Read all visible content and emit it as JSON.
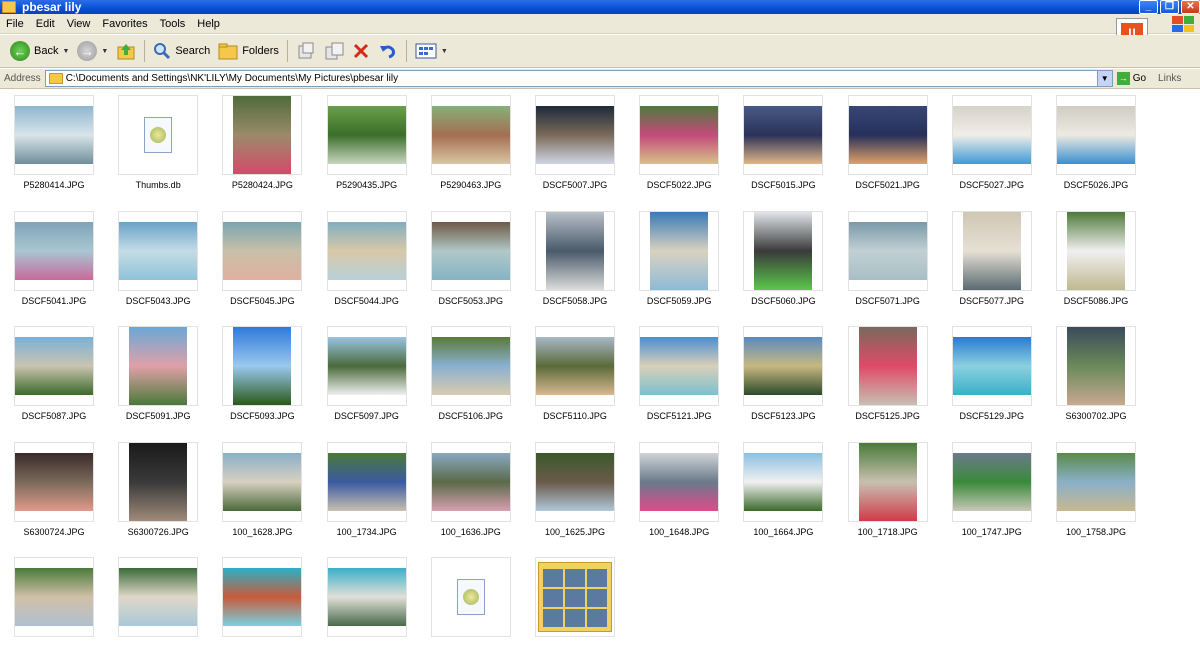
{
  "window": {
    "title": "pbesar lily",
    "min": "_",
    "max": "❐",
    "close": "✕"
  },
  "menu": [
    "File",
    "Edit",
    "View",
    "Favorites",
    "Tools",
    "Help"
  ],
  "toolbar": {
    "back": "Back",
    "search": "Search",
    "folders": "Folders"
  },
  "address": {
    "label": "Address",
    "path": "C:\\Documents and Settings\\NK'LILY\\My Documents\\My Pictures\\pbesar lily",
    "go": "Go",
    "links": "Links"
  },
  "files": [
    {
      "name": "P5280414.JPG",
      "kind": "land",
      "colors": [
        "#8fb6cf",
        "#6f8f9a",
        "#d8e4ea"
      ]
    },
    {
      "name": "Thumbs.db",
      "kind": "db"
    },
    {
      "name": "P5280424.JPG",
      "kind": "port",
      "colors": [
        "#4f6b3a",
        "#d44a6a",
        "#9c8a6a"
      ]
    },
    {
      "name": "P5290435.JPG",
      "kind": "land",
      "colors": [
        "#6aa04a",
        "#c9d6c0",
        "#3b6e2a"
      ]
    },
    {
      "name": "P5290463.JPG",
      "kind": "land",
      "colors": [
        "#86b07a",
        "#d9c6a4",
        "#a46e52"
      ]
    },
    {
      "name": "DSCF5007.JPG",
      "kind": "land",
      "colors": [
        "#1e2a3a",
        "#cfd6e2",
        "#7a6a5a"
      ]
    },
    {
      "name": "DSCF5022.JPG",
      "kind": "land",
      "colors": [
        "#4e7a3c",
        "#d7c08a",
        "#c44a7a"
      ]
    },
    {
      "name": "DSCF5015.JPG",
      "kind": "land",
      "colors": [
        "#4a5a86",
        "#e2b58a",
        "#2a3258"
      ]
    },
    {
      "name": "DSCF5021.JPG",
      "kind": "land",
      "colors": [
        "#384676",
        "#e0a268",
        "#26305a"
      ]
    },
    {
      "name": "DSCF5027.JPG",
      "kind": "land",
      "colors": [
        "#d6d2c8",
        "#3f9ad6",
        "#f0eee8"
      ]
    },
    {
      "name": "DSCF5026.JPG",
      "kind": "land",
      "colors": [
        "#d0ccc2",
        "#3a8fd0",
        "#eceae2"
      ]
    },
    {
      "name": "DSCF5041.JPG",
      "kind": "land",
      "colors": [
        "#7ea4b8",
        "#c86a9a",
        "#a8c6d2"
      ]
    },
    {
      "name": "DSCF5043.JPG",
      "kind": "land",
      "colors": [
        "#6aa2c8",
        "#8fc2d8",
        "#c4dce6"
      ]
    },
    {
      "name": "DSCF5045.JPG",
      "kind": "land",
      "colors": [
        "#7aa6b0",
        "#e0b0a0",
        "#c8c0a8"
      ]
    },
    {
      "name": "DSCF5044.JPG",
      "kind": "land",
      "colors": [
        "#82aec0",
        "#b8d0d8",
        "#d8c8a8"
      ]
    },
    {
      "name": "DSCF5053.JPG",
      "kind": "land",
      "colors": [
        "#6e5a46",
        "#86b4c4",
        "#b0c8c8"
      ]
    },
    {
      "name": "DSCF5058.JPG",
      "kind": "port",
      "colors": [
        "#b8c0c8",
        "#dcdcdc",
        "#4a5a6a"
      ]
    },
    {
      "name": "DSCF5059.JPG",
      "kind": "port",
      "colors": [
        "#3a7ab8",
        "#8ebad6",
        "#d8d2c0"
      ]
    },
    {
      "name": "DSCF5060.JPG",
      "kind": "port",
      "colors": [
        "#e2e6ea",
        "#5ac84a",
        "#3a3a3a"
      ]
    },
    {
      "name": "DSCF5071.JPG",
      "kind": "land",
      "colors": [
        "#7a9aa8",
        "#a8bec6",
        "#c2d0d4"
      ]
    },
    {
      "name": "DSCF5077.JPG",
      "kind": "port",
      "colors": [
        "#d0c6b4",
        "#5a6a72",
        "#e6e0d4"
      ]
    },
    {
      "name": "DSCF5086.JPG",
      "kind": "port",
      "colors": [
        "#4e7a3a",
        "#c0b890",
        "#f0f0f0"
      ]
    },
    {
      "name": "DSCF5087.JPG",
      "kind": "land",
      "colors": [
        "#7ab0d8",
        "#3c6a2a",
        "#c9c4b0"
      ]
    },
    {
      "name": "DSCF5091.JPG",
      "kind": "port",
      "colors": [
        "#6aa8d8",
        "#4a7a3a",
        "#e0a0a8"
      ]
    },
    {
      "name": "DSCF5093.JPG",
      "kind": "port",
      "colors": [
        "#2f7ad8",
        "#2a5a1a",
        "#9ac8f0"
      ]
    },
    {
      "name": "DSCF5097.JPG",
      "kind": "land",
      "colors": [
        "#9ac4e2",
        "#f0f0f0",
        "#4a6a3a"
      ]
    },
    {
      "name": "DSCF5106.JPG",
      "kind": "land",
      "colors": [
        "#5a7a3a",
        "#d8cbb0",
        "#8ab0d0"
      ]
    },
    {
      "name": "DSCF5110.JPG",
      "kind": "land",
      "colors": [
        "#a8b8c8",
        "#d8b890",
        "#5a6a3a"
      ]
    },
    {
      "name": "DSCF5121.JPG",
      "kind": "land",
      "colors": [
        "#4a8ed0",
        "#7ac0d0",
        "#d8d0b8"
      ]
    },
    {
      "name": "DSCF5123.JPG",
      "kind": "land",
      "colors": [
        "#5a8ac0",
        "#2a4a2a",
        "#c8b880"
      ]
    },
    {
      "name": "DSCF5125.JPG",
      "kind": "port",
      "colors": [
        "#7a6a5a",
        "#c8c0b0",
        "#e04a6a"
      ]
    },
    {
      "name": "DSCF5129.JPG",
      "kind": "land",
      "colors": [
        "#2a7ad0",
        "#3ab0c8",
        "#8ad0e0"
      ]
    },
    {
      "name": "S6300702.JPG",
      "kind": "port",
      "colors": [
        "#3a4a5a",
        "#c8a890",
        "#6a8a5a"
      ]
    },
    {
      "name": "S6300724.JPG",
      "kind": "land",
      "colors": [
        "#3a2a2a",
        "#e09a8a",
        "#7a6a5a"
      ]
    },
    {
      "name": "S6300726.JPG",
      "kind": "port",
      "colors": [
        "#1a1a1a",
        "#a08a7a",
        "#3a3a3a"
      ]
    },
    {
      "name": "100_1628.JPG",
      "kind": "land",
      "colors": [
        "#8ab0c8",
        "#4a6a3a",
        "#d8d0c0"
      ]
    },
    {
      "name": "100_1734.JPG",
      "kind": "land",
      "colors": [
        "#4a7a3a",
        "#c8c0b0",
        "#3a5aa0"
      ]
    },
    {
      "name": "100_1636.JPG",
      "kind": "land",
      "colors": [
        "#8aa8c0",
        "#d8a0b0",
        "#5a6a4a"
      ]
    },
    {
      "name": "100_1625.JPG",
      "kind": "land",
      "colors": [
        "#3a5a2a",
        "#b0c8d8",
        "#6a5a4a"
      ]
    },
    {
      "name": "100_1648.JPG",
      "kind": "land",
      "colors": [
        "#d0d4d8",
        "#e04a8a",
        "#6a7a8a"
      ]
    },
    {
      "name": "100_1664.JPG",
      "kind": "land",
      "colors": [
        "#8ac0e0",
        "#3a6a2a",
        "#f0f0f0"
      ]
    },
    {
      "name": "100_1718.JPG",
      "kind": "port",
      "colors": [
        "#4a7a3a",
        "#d03a4a",
        "#c8c0b0"
      ]
    },
    {
      "name": "100_1747.JPG",
      "kind": "land",
      "colors": [
        "#6a7a8a",
        "#c8c8b8",
        "#3a8a3a"
      ]
    },
    {
      "name": "100_1758.JPG",
      "kind": "land",
      "colors": [
        "#5a8a4a",
        "#c8b890",
        "#8ab0c8"
      ]
    },
    {
      "name": "",
      "kind": "land",
      "colors": [
        "#4a7a3a",
        "#b0c0d0",
        "#d0c0a8"
      ]
    },
    {
      "name": "",
      "kind": "land",
      "colors": [
        "#3a6a3a",
        "#a8c8d8",
        "#e0d8c8"
      ]
    },
    {
      "name": "",
      "kind": "land",
      "colors": [
        "#2ab0c8",
        "#7ad0e0",
        "#c85a3a"
      ]
    },
    {
      "name": "",
      "kind": "land",
      "colors": [
        "#3ab0c8",
        "#4a6a4a",
        "#e0e0d8"
      ]
    },
    {
      "name": "",
      "kind": "db"
    },
    {
      "name": "",
      "kind": "folder"
    }
  ]
}
